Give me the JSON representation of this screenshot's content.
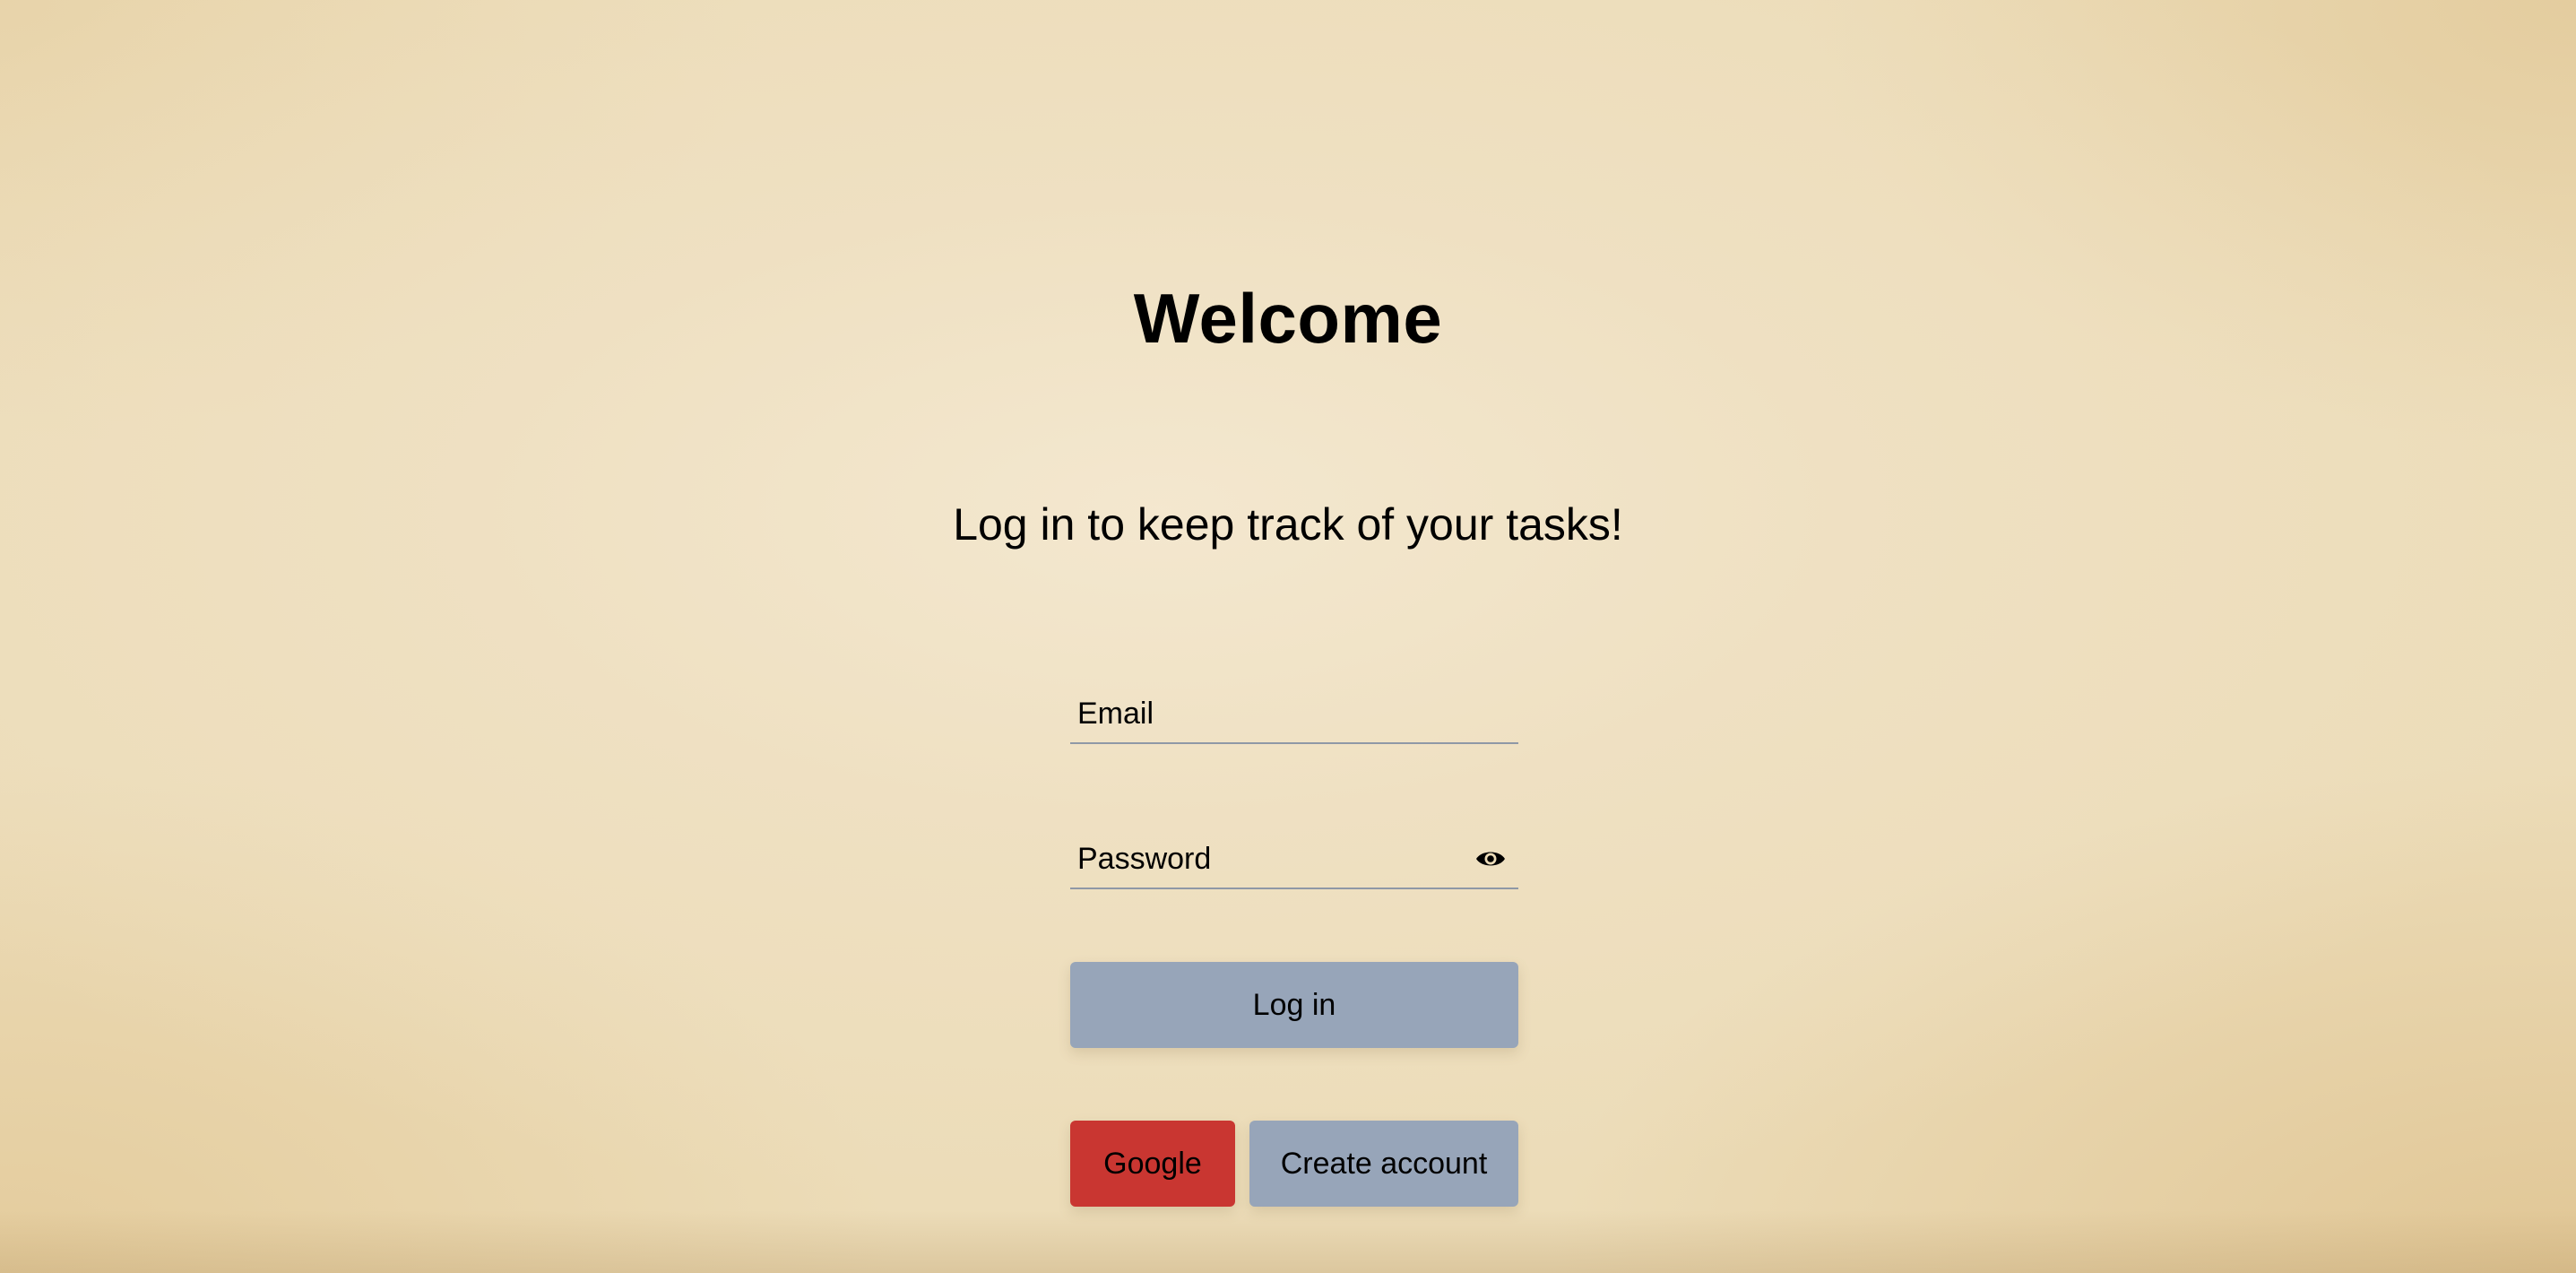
{
  "page": {
    "title": "Welcome",
    "subtitle": "Log in to keep track of your tasks!"
  },
  "form": {
    "email": {
      "placeholder": "Email",
      "value": ""
    },
    "password": {
      "placeholder": "Password",
      "value": "",
      "toggle_icon": "eye-icon"
    },
    "login_label": "Log in",
    "google_label": "Google",
    "create_account_label": "Create account"
  },
  "colors": {
    "primary_button": "#97a5b9",
    "google_button": "#c93631",
    "background": "#ecdcb8",
    "field_underline": "#8f98a6"
  }
}
